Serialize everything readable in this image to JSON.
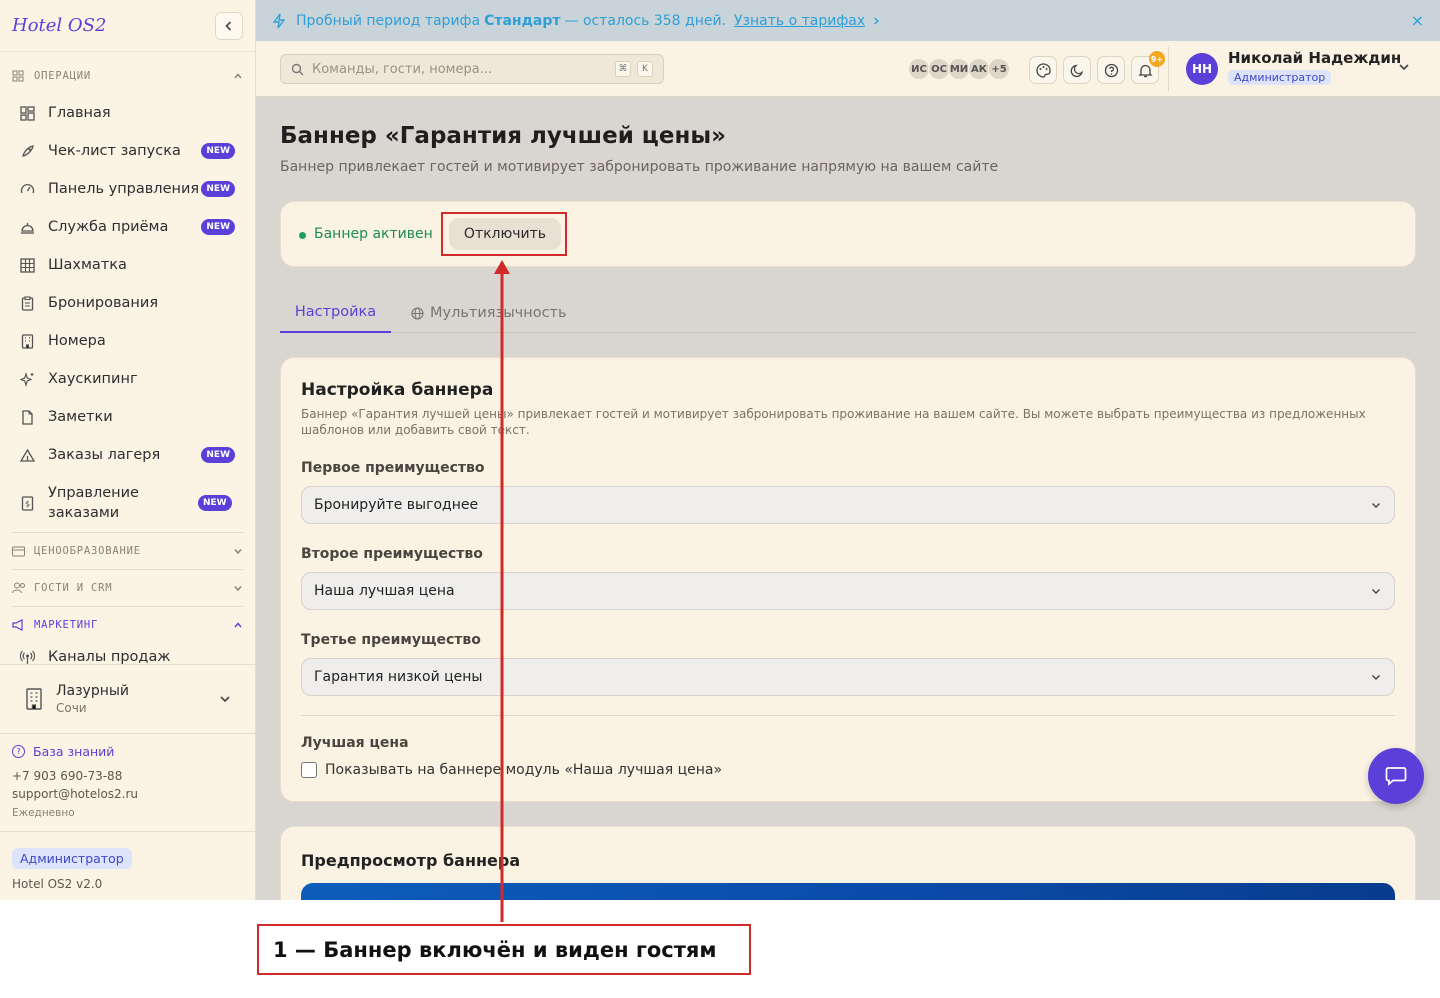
{
  "sidebar": {
    "brand": "Hotel OS2",
    "sections": [
      {
        "label": "ОПЕРАЦИИ",
        "expanded": true
      },
      {
        "label": "ЦЕНООБРАЗОВАНИЕ",
        "expanded": false
      },
      {
        "label": "ГОСТИ И CRM",
        "expanded": false
      },
      {
        "label": "МАРКЕТИНГ",
        "expanded": true
      }
    ],
    "items": [
      {
        "label": "Главная",
        "icon": "dashboard-icon"
      },
      {
        "label": "Чек-лист запуска",
        "icon": "rocket-icon",
        "badge": "NEW"
      },
      {
        "label": "Панель управления",
        "icon": "gauge-icon",
        "badge": "NEW"
      },
      {
        "label": "Служба приёма",
        "icon": "bell-desk-icon",
        "badge": "NEW"
      },
      {
        "label": "Шахматка",
        "icon": "grid-icon"
      },
      {
        "label": "Бронирования",
        "icon": "clipboard-icon"
      },
      {
        "label": "Номера",
        "icon": "building-icon"
      },
      {
        "label": "Хаускипинг",
        "icon": "sparkles-icon"
      },
      {
        "label": "Заметки",
        "icon": "note-icon"
      },
      {
        "label": "Заказы лагеря",
        "icon": "tent-icon",
        "badge": "NEW"
      },
      {
        "label": "Управление заказами",
        "icon": "receipt-icon",
        "badge": "NEW"
      },
      {
        "label": "Каналы продаж",
        "icon": "broadcast-icon"
      }
    ],
    "hotel": {
      "name": "Лазурный",
      "city": "Сочи"
    },
    "support": {
      "kb_label": "База знаний",
      "phone": "+7 903 690-73-88",
      "email": "support@hotelos2.ru",
      "schedule": "Ежедневно"
    },
    "footer": {
      "role": "Администратор",
      "version": "Hotel OS2 v2.0"
    }
  },
  "trial": {
    "text_before": "Пробный период тарифа",
    "plan": "Стандарт",
    "text_after": "— осталось 358 дней.",
    "link": "Узнать о тарифах",
    "close": "×"
  },
  "topbar": {
    "search_placeholder": "Команды, гости, номера...",
    "kbd": [
      "⌘",
      "K"
    ],
    "avatars": [
      "ИС",
      "ОС",
      "МИ",
      "АК",
      "+5"
    ],
    "notif_count": "9+",
    "user": {
      "initials": "НН",
      "name": "Николай Надеждин",
      "role": "Администратор"
    }
  },
  "main": {
    "title": "Баннер «Гарантия лучшей цены»",
    "subtitle": "Баннер привлекает гостей и мотивирует забронировать проживание напрямую на вашем сайте",
    "status": {
      "text": "Баннер активен",
      "button": "Отключить"
    },
    "tabs": [
      {
        "label": "Настройка",
        "active": true
      },
      {
        "label": "Мультиязычность",
        "active": false
      }
    ],
    "settings": {
      "title": "Настройка баннера",
      "description": "Баннер «Гарантия лучшей цены» привлекает гостей и мотивирует забронировать проживание на вашем сайте. Вы можете выбрать преимущества из предложенных шаблонов или добавить свой текст.",
      "fields": [
        {
          "label": "Первое преимущество",
          "value": "Бронируйте выгоднее"
        },
        {
          "label": "Второе преимущество",
          "value": "Наша лучшая цена"
        },
        {
          "label": "Третье преимущество",
          "value": "Гарантия низкой цены"
        }
      ],
      "best_price_label": "Лучшая цена",
      "checkbox_label": "Показывать на баннере модуль «Наша лучшая цена»",
      "checkbox_checked": false
    },
    "preview": {
      "title": "Предпросмотр баннера"
    }
  },
  "annotation": {
    "caption": "1 — Баннер включён и виден гостям",
    "color": "#d22a2a"
  }
}
